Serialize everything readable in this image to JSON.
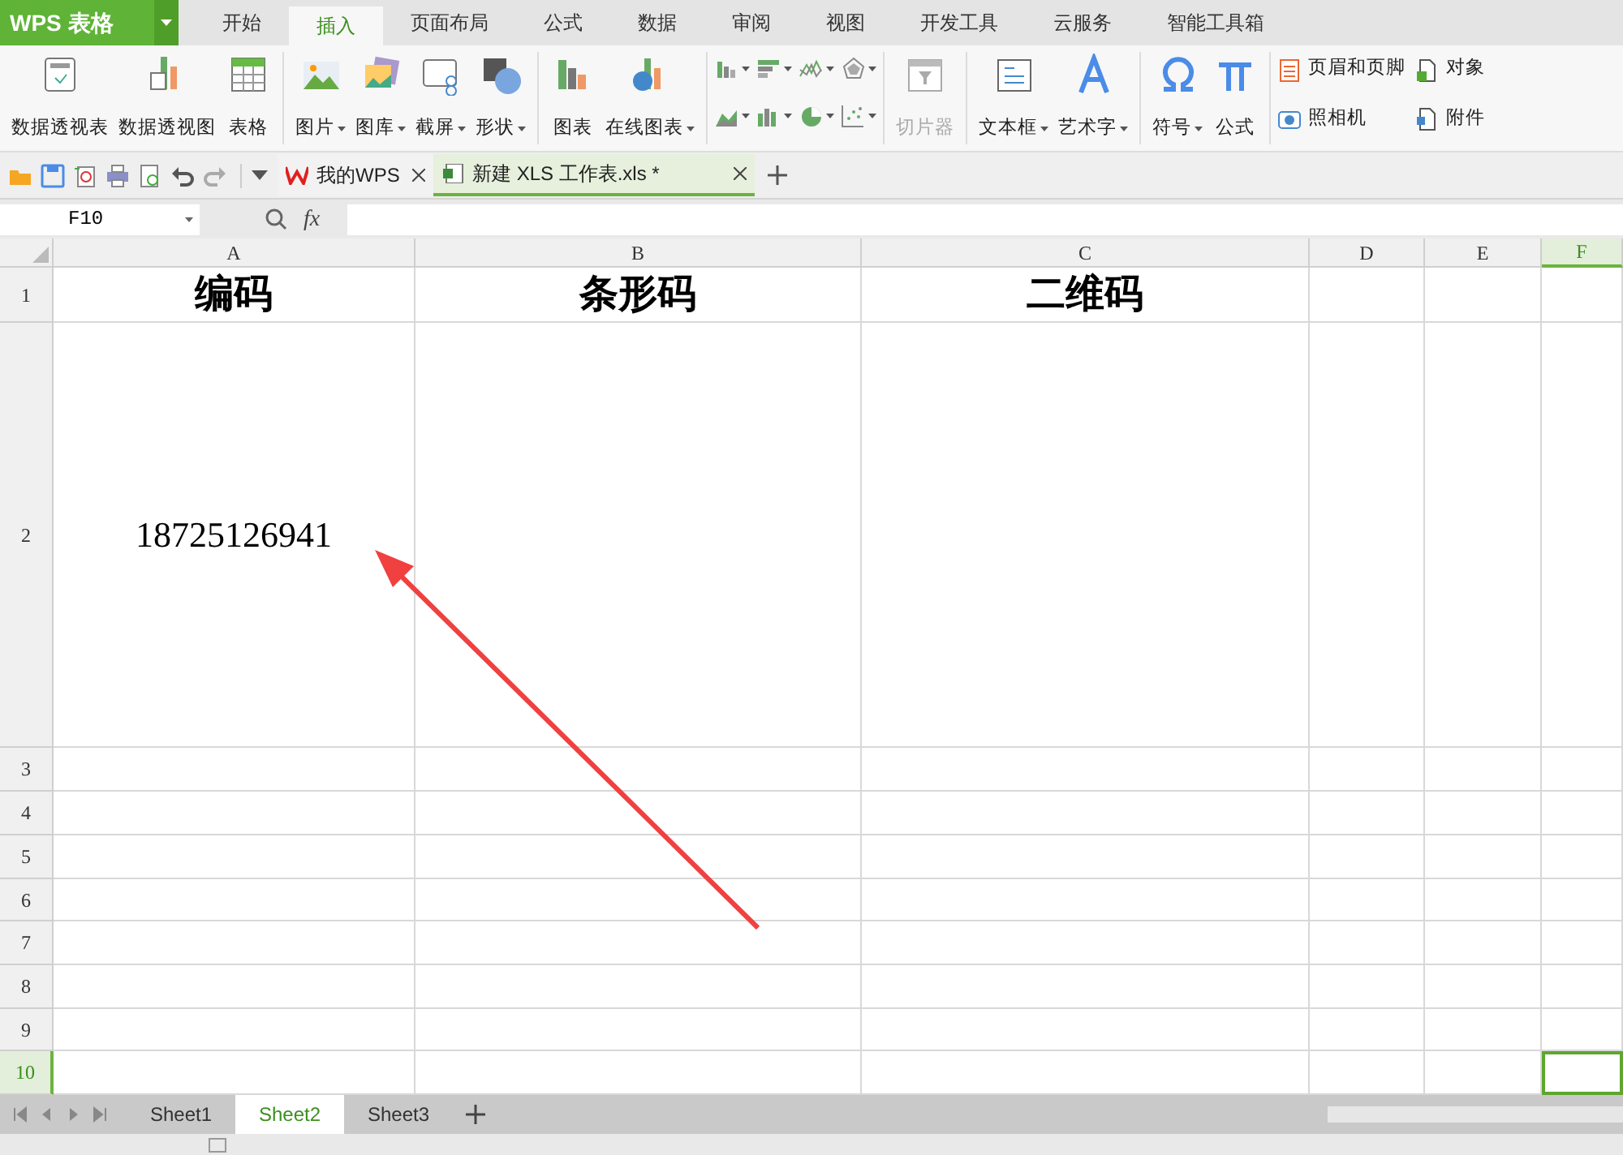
{
  "app": {
    "title": "WPS 表格"
  },
  "menu_tabs": [
    {
      "label": "开始",
      "selected": false
    },
    {
      "label": "插入",
      "selected": true
    },
    {
      "label": "页面布局",
      "selected": false
    },
    {
      "label": "公式",
      "selected": false
    },
    {
      "label": "数据",
      "selected": false
    },
    {
      "label": "审阅",
      "selected": false
    },
    {
      "label": "视图",
      "selected": false
    },
    {
      "label": "开发工具",
      "selected": false
    },
    {
      "label": "云服务",
      "selected": false
    },
    {
      "label": "智能工具箱",
      "selected": false
    }
  ],
  "ribbon": {
    "groups": [
      {
        "kind": "large",
        "buttons": [
          {
            "label": "数据透视表",
            "dropdown": false,
            "disabled": false
          },
          {
            "label": "数据透视图",
            "dropdown": false,
            "disabled": false
          },
          {
            "label": "表格",
            "dropdown": false,
            "disabled": false
          }
        ]
      },
      {
        "kind": "large",
        "buttons": [
          {
            "label": "图片",
            "dropdown": true,
            "disabled": false
          },
          {
            "label": "图库",
            "dropdown": true,
            "disabled": false
          },
          {
            "label": "截屏",
            "dropdown": true,
            "disabled": false
          },
          {
            "label": "形状",
            "dropdown": true,
            "disabled": false
          }
        ]
      },
      {
        "kind": "large",
        "buttons": [
          {
            "label": "图表",
            "dropdown": false,
            "disabled": false
          },
          {
            "label": "在线图表",
            "dropdown": true,
            "disabled": false
          }
        ]
      },
      {
        "kind": "icons"
      },
      {
        "kind": "large",
        "buttons": [
          {
            "label": "切片器",
            "dropdown": false,
            "disabled": true
          }
        ]
      },
      {
        "kind": "large",
        "buttons": [
          {
            "label": "文本框",
            "dropdown": true,
            "disabled": false
          },
          {
            "label": "艺术字",
            "dropdown": true,
            "disabled": false
          }
        ]
      },
      {
        "kind": "large",
        "buttons": [
          {
            "label": "符号",
            "dropdown": true,
            "disabled": false
          },
          {
            "label": "公式",
            "dropdown": false,
            "disabled": false
          }
        ]
      },
      {
        "kind": "small",
        "buttons": [
          {
            "label": "页眉和页脚"
          },
          {
            "label": "照相机"
          },
          {
            "label": "对象"
          },
          {
            "label": "附件"
          }
        ]
      }
    ]
  },
  "doc_tabs": [
    {
      "label": "我的WPS",
      "selected": false
    },
    {
      "label": "新建 XLS 工作表.xls *",
      "selected": true
    }
  ],
  "formula_bar": {
    "name_box": "F10",
    "function_label": "fx"
  },
  "sheet": {
    "columns": [
      {
        "label": "A",
        "selected": false
      },
      {
        "label": "B",
        "selected": false
      },
      {
        "label": "C",
        "selected": false
      },
      {
        "label": "D",
        "selected": false
      },
      {
        "label": "E",
        "selected": false
      },
      {
        "label": "F",
        "selected": true
      }
    ],
    "rows": [
      {
        "label": "1",
        "selected": false,
        "cells": [
          "编码",
          "条形码",
          "二维码"
        ]
      },
      {
        "label": "2",
        "selected": false,
        "cells": [
          "18725126941"
        ]
      },
      {
        "label": "3",
        "selected": false,
        "cells": []
      },
      {
        "label": "4",
        "selected": false,
        "cells": []
      },
      {
        "label": "5",
        "selected": false,
        "cells": []
      },
      {
        "label": "6",
        "selected": false,
        "cells": []
      },
      {
        "label": "7",
        "selected": false,
        "cells": []
      },
      {
        "label": "8",
        "selected": false,
        "cells": []
      },
      {
        "label": "9",
        "selected": false,
        "cells": []
      },
      {
        "label": "10",
        "selected": true,
        "cells": []
      }
    ]
  },
  "sheet_tabs": [
    {
      "label": "Sheet1",
      "selected": false
    },
    {
      "label": "Sheet2",
      "selected": true
    },
    {
      "label": "Sheet3",
      "selected": false
    }
  ]
}
